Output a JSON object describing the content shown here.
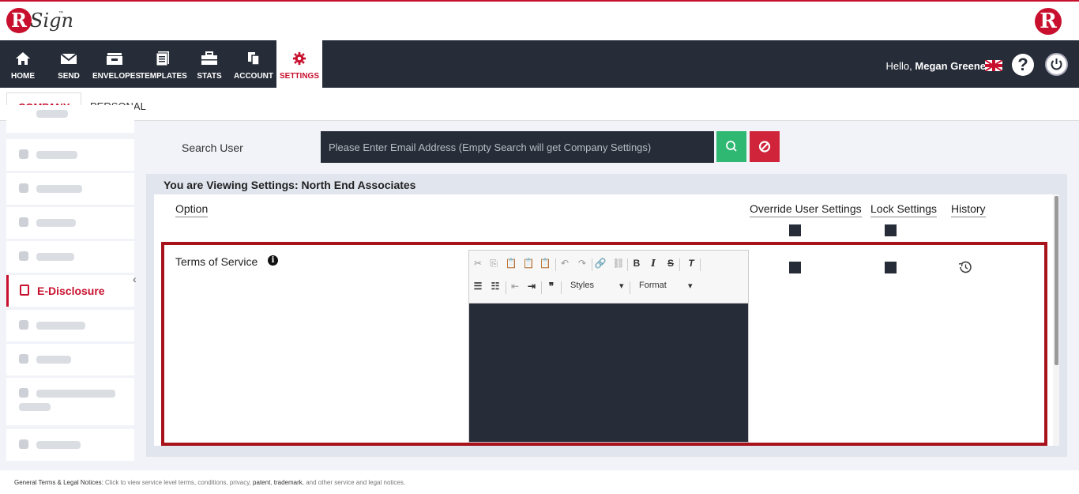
{
  "brand": {
    "logo_letter": "R",
    "logo_word": "Sign",
    "logo_tm": "™",
    "right_letter": "R"
  },
  "nav": {
    "items": [
      {
        "label": "HOME"
      },
      {
        "label": "SEND"
      },
      {
        "label": "ENVELOPES"
      },
      {
        "label": "TEMPLATES"
      },
      {
        "label": "STATS"
      },
      {
        "label": "ACCOUNT"
      },
      {
        "label": "SETTINGS"
      }
    ],
    "greeting": "Hello,",
    "user_name": "Megan Greene",
    "help_label": "?"
  },
  "subtabs": {
    "company": "COMPANY",
    "personal": "PERSONAL"
  },
  "sidebar": {
    "active_label": "E-Disclosure",
    "collapse_glyph": "‹"
  },
  "search": {
    "label": "Search User",
    "placeholder": "Please Enter Email Address (Empty Search will get Company Settings)"
  },
  "panel": {
    "title": "You are Viewing Settings: North End Associates",
    "columns": {
      "option": "Option",
      "override": "Override User Settings",
      "lock": "Lock Settings",
      "history": "History"
    },
    "row": {
      "label": "Terms of Service",
      "info_glyph": "i"
    }
  },
  "editor": {
    "styles_label": "Styles",
    "format_label": "Format"
  },
  "footer": {
    "prefix": "General Terms & Legal Notices:",
    "text1": " Click to view service level terms, conditions, privacy, ",
    "patent": "patent",
    "comma": ", ",
    "trademark": "trademark",
    "text2": ", and other service and legal notices."
  },
  "colors": {
    "accent": "#c8102e",
    "nav_bg": "#262d38",
    "search_btn": "#2eb872",
    "clear_btn": "#d0243b",
    "highlight": "#a8121b"
  }
}
